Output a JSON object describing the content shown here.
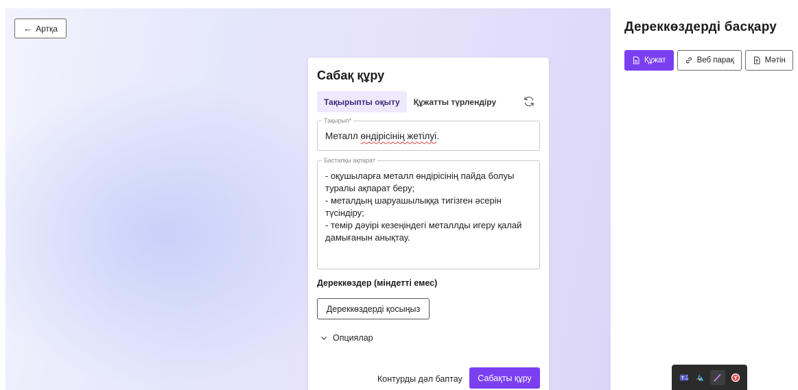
{
  "back_button": {
    "label": "Артқа",
    "icon": "arrow-left-icon"
  },
  "card": {
    "title": "Сабақ құру",
    "tabs": [
      {
        "label": "Тақырыпты оқыту",
        "active": true
      },
      {
        "label": "Құжатты түрлендіру",
        "active": false
      }
    ],
    "refresh_icon": "refresh-icon",
    "topic": {
      "legend": "Тақырып*",
      "value_plain": "Металл ",
      "value_underlined": "өндірісінің жетілуі",
      "value_end": "."
    },
    "info": {
      "legend": "Бастапқы ақпарат",
      "value": "- оқушыларға металл өндірісінің пайда болуы туралы ақпарат беру;\n- металдың шаруашылыққа тигізген әсерін түсіндіру;\n- темір дәуірі кезеңіндегі металлды игеру қалай дамығанын анықтау."
    },
    "sources_label": "Дереккөздер (міндетті емес)",
    "add_sources_button": "Дереккөздерді қосыңыз",
    "options_label": "Опциялар",
    "outline_link": "Контурды дәл баптау",
    "create_button": "Сабақты құру"
  },
  "right_panel": {
    "title": "Дереккөздерді басқару",
    "tabs": [
      {
        "label": "Құжат",
        "icon": "document-icon",
        "active": true
      },
      {
        "label": "Веб парақ",
        "icon": "link-icon",
        "active": false
      },
      {
        "label": "Мәтін",
        "icon": "text-file-icon",
        "active": false
      }
    ]
  },
  "taskbar": {
    "icons": [
      "teams-icon",
      "azure-icon",
      "pen-icon",
      "yandex-browser-icon"
    ]
  },
  "colors": {
    "accent": "#7b3ff2",
    "tab_active_bg": "#efe9ff"
  }
}
